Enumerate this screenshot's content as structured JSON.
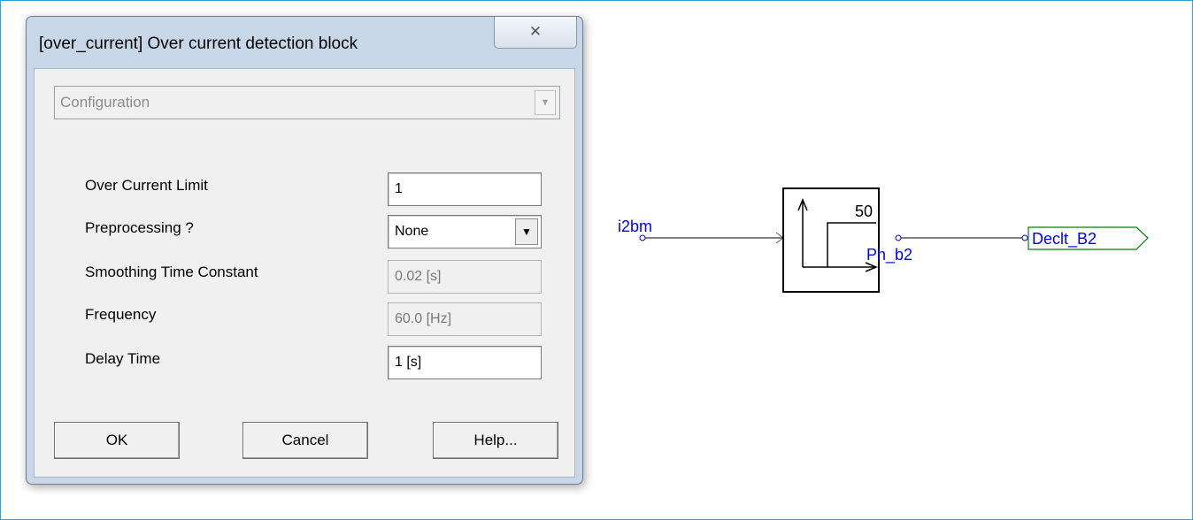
{
  "dialog": {
    "title": "[over_current] Over current detection block",
    "close_glyph": "✕",
    "section_select": "Configuration",
    "fields": [
      {
        "label": "Over Current Limit",
        "value": "1",
        "enabled": true
      },
      {
        "label": "Preprocessing ?",
        "value": "None",
        "enabled": true,
        "type": "select"
      },
      {
        "label": "Smoothing Time Constant",
        "value": "0.02 [s]",
        "enabled": false
      },
      {
        "label": "Frequency",
        "value": "60.0 [Hz]",
        "enabled": false
      },
      {
        "label": "Delay Time",
        "value": "1 [s]",
        "enabled": true
      }
    ],
    "buttons": {
      "ok": "OK",
      "cancel": "Cancel",
      "help": "Help..."
    }
  },
  "diagram": {
    "input_label": "i2bm",
    "block_setting": "50",
    "block_output_label": "Ph_b2",
    "output_tag": "Declt_B2",
    "colors": {
      "wire": "#000000",
      "label": "#0000ff",
      "tag_border": "#008000",
      "frame": "#29a3d6"
    }
  }
}
